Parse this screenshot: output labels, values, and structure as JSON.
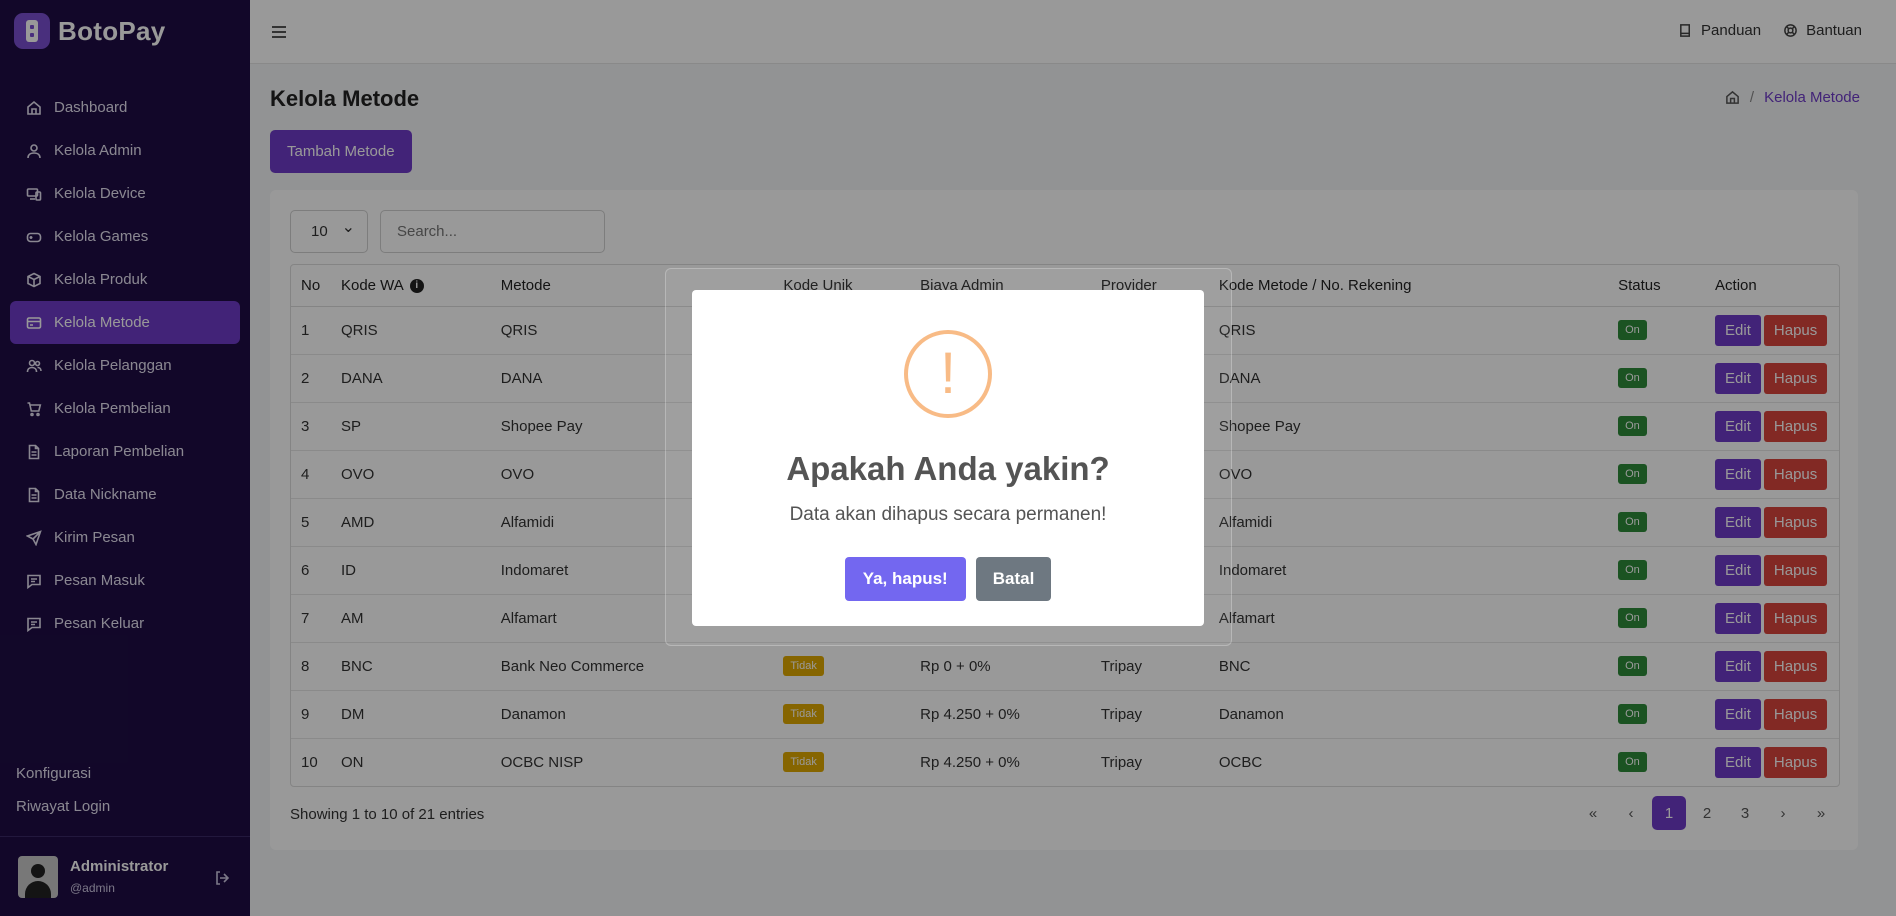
{
  "brand": {
    "name": "BotoPay"
  },
  "sidebar": {
    "items": [
      {
        "label": "Dashboard",
        "icon": "home-icon",
        "active": false
      },
      {
        "label": "Kelola Admin",
        "icon": "user-icon",
        "active": false
      },
      {
        "label": "Kelola Device",
        "icon": "devices-icon",
        "active": false
      },
      {
        "label": "Kelola Games",
        "icon": "gamepad-icon",
        "active": false
      },
      {
        "label": "Kelola Produk",
        "icon": "box-icon",
        "active": false
      },
      {
        "label": "Kelola Metode",
        "icon": "credit-card-icon",
        "active": true
      },
      {
        "label": "Kelola Pelanggan",
        "icon": "users-icon",
        "active": false
      },
      {
        "label": "Kelola Pembelian",
        "icon": "cart-icon",
        "active": false
      },
      {
        "label": "Laporan Pembelian",
        "icon": "file-icon",
        "active": false
      },
      {
        "label": "Data Nickname",
        "icon": "file-icon",
        "active": false
      },
      {
        "label": "Kirim Pesan",
        "icon": "send-icon",
        "active": false
      },
      {
        "label": "Pesan Masuk",
        "icon": "message-icon",
        "active": false
      },
      {
        "label": "Pesan Keluar",
        "icon": "message-icon",
        "active": false
      }
    ],
    "bottom_links": [
      "Konfigurasi",
      "Riwayat Login"
    ],
    "user": {
      "name": "Administrator",
      "handle": "@admin"
    }
  },
  "topbar": {
    "links": [
      {
        "label": "Panduan",
        "icon": "book-icon"
      },
      {
        "label": "Bantuan",
        "icon": "lifebuoy-icon"
      }
    ]
  },
  "page": {
    "title": "Kelola Metode",
    "breadcrumb_current": "Kelola Metode",
    "add_button": "Tambah Metode"
  },
  "table": {
    "page_size": "10",
    "search_placeholder": "Search...",
    "columns": [
      "No",
      "Kode WA",
      "Metode",
      "Kode Unik",
      "Biaya Admin",
      "Provider",
      "Kode Metode / No. Rekening",
      "Status",
      "Action"
    ],
    "rows": [
      {
        "no": "1",
        "kode_wa": "QRIS",
        "metode": "QRIS",
        "kode_unik": "",
        "biaya": "",
        "provider": "",
        "kode_metode": "QRIS",
        "status": "On"
      },
      {
        "no": "2",
        "kode_wa": "DANA",
        "metode": "DANA",
        "kode_unik": "",
        "biaya": "",
        "provider": "",
        "kode_metode": "DANA",
        "status": "On"
      },
      {
        "no": "3",
        "kode_wa": "SP",
        "metode": "Shopee Pay",
        "kode_unik": "",
        "biaya": "",
        "provider": "",
        "kode_metode": "Shopee Pay",
        "status": "On"
      },
      {
        "no": "4",
        "kode_wa": "OVO",
        "metode": "OVO",
        "kode_unik": "",
        "biaya": "",
        "provider": "",
        "kode_metode": "OVO",
        "status": "On"
      },
      {
        "no": "5",
        "kode_wa": "AMD",
        "metode": "Alfamidi",
        "kode_unik": "",
        "biaya": "",
        "provider": "",
        "kode_metode": "Alfamidi",
        "status": "On"
      },
      {
        "no": "6",
        "kode_wa": "ID",
        "metode": "Indomaret",
        "kode_unik": "",
        "biaya": "",
        "provider": "",
        "kode_metode": "Indomaret",
        "status": "On"
      },
      {
        "no": "7",
        "kode_wa": "AM",
        "metode": "Alfamart",
        "kode_unik": "",
        "biaya": "",
        "provider": "",
        "kode_metode": "Alfamart",
        "status": "On"
      },
      {
        "no": "8",
        "kode_wa": "BNC",
        "metode": "Bank Neo Commerce",
        "kode_unik": "Tidak",
        "biaya": "Rp 0 + 0%",
        "provider": "Tripay",
        "kode_metode": "BNC",
        "status": "On"
      },
      {
        "no": "9",
        "kode_wa": "DM",
        "metode": "Danamon",
        "kode_unik": "Tidak",
        "biaya": "Rp 4.250 + 0%",
        "provider": "Tripay",
        "kode_metode": "Danamon",
        "status": "On"
      },
      {
        "no": "10",
        "kode_wa": "ON",
        "metode": "OCBC NISP",
        "kode_unik": "Tidak",
        "biaya": "Rp 4.250 + 0%",
        "provider": "Tripay",
        "kode_metode": "OCBC",
        "status": "On"
      }
    ],
    "edit_label": "Edit",
    "delete_label": "Hapus",
    "entries_text": "Showing 1 to 10 of 21 entries",
    "pagination": [
      "«",
      "‹",
      "1",
      "2",
      "3",
      "›",
      "»"
    ],
    "active_page": "1"
  },
  "modal": {
    "title": "Apakah Anda yakin?",
    "text": "Data akan dihapus secara permanen!",
    "confirm_label": "Ya, hapus!",
    "cancel_label": "Batal"
  },
  "colors": {
    "sidebar_bg": "#1e0d45",
    "accent": "#6f3bc8",
    "danger": "#d9453d",
    "success": "#2e8b3a",
    "warning": "#e0a800",
    "confirm": "#7367f0"
  }
}
